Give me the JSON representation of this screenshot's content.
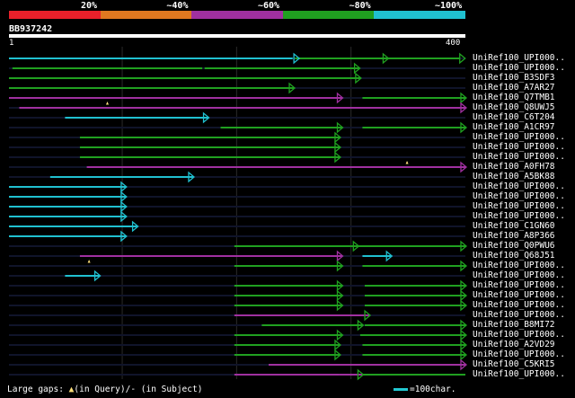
{
  "colors": {
    "bg": "#000000",
    "c20": "#e8202a",
    "c40": "#e07820",
    "c60": "#a030a0",
    "c80": "#20a020",
    "c100": "#20c0d0",
    "query": "#ffffff",
    "gap": "#ffe07a"
  },
  "legend": {
    "labels": [
      "20%",
      "~40%",
      "~60%",
      "~80%",
      "~100%"
    ]
  },
  "query": {
    "id": "BB937242",
    "start_label": "1",
    "end_label": "400",
    "length": 400
  },
  "hits": [
    {
      "name": "UniRef100_UPI000..",
      "color": "c100",
      "segs": [
        [
          1,
          249
        ],
        [
          251,
          254
        ],
        [
          325,
          332
        ]
      ],
      "arrows": [
        [
          254,
          "c100"
        ],
        [
          332,
          "c80"
        ],
        [
          399,
          "c80"
        ]
      ],
      "cont": [
        [
          254,
          325,
          "c80"
        ],
        [
          332,
          395,
          "c80"
        ]
      ]
    },
    {
      "name": "UniRef100_UPI000..",
      "color": "c80",
      "segs": [
        [
          4,
          170
        ],
        [
          172,
          307
        ]
      ],
      "arrows": [
        [
          307,
          "c80"
        ]
      ],
      "cont": []
    },
    {
      "name": "UniRef100_B3SDF3",
      "color": "c80",
      "segs": [
        [
          1,
          308
        ]
      ],
      "arrows": [
        [
          308,
          "c80"
        ]
      ],
      "cont": []
    },
    {
      "name": "UniRef100_A7AR27",
      "color": "c80",
      "segs": [
        [
          1,
          250
        ]
      ],
      "arrows": [
        [
          250,
          "c80"
        ]
      ],
      "cont": []
    },
    {
      "name": "UniRef100_Q7TMB1",
      "color": "c60",
      "segs": [
        [
          1,
          292
        ],
        [
          310,
          400
        ]
      ],
      "arrows": [
        [
          292,
          "c60"
        ],
        [
          400,
          "c80"
        ]
      ],
      "cont": []
    },
    {
      "name": "UniRef100_Q8UWJ5",
      "color": "c60",
      "segs": [
        [
          10,
          400
        ]
      ],
      "arrows": [
        [
          400,
          "c60"
        ]
      ],
      "cont": []
    },
    {
      "name": "UniRef100_C6T204",
      "color": "c100",
      "segs": [
        [
          50,
          175
        ]
      ],
      "arrows": [
        [
          175,
          "c100"
        ]
      ],
      "cont": []
    },
    {
      "name": "UniRef100_A1CR97",
      "color": "c80",
      "segs": [
        [
          186,
          292
        ],
        [
          310,
          400
        ]
      ],
      "arrows": [
        [
          292,
          "c80"
        ],
        [
          400,
          "c80"
        ]
      ],
      "cont": []
    },
    {
      "name": "UniRef100_UPI000..",
      "color": "c80",
      "segs": [
        [
          63,
          290
        ]
      ],
      "arrows": [
        [
          290,
          "c80"
        ]
      ],
      "cont": []
    },
    {
      "name": "UniRef100_UPI000..",
      "color": "c80",
      "segs": [
        [
          63,
          290
        ]
      ],
      "arrows": [
        [
          290,
          "c80"
        ]
      ],
      "cont": []
    },
    {
      "name": "UniRef100_UPI000..",
      "color": "c80",
      "segs": [
        [
          63,
          290
        ]
      ],
      "arrows": [
        [
          290,
          "c80"
        ]
      ],
      "cont": []
    },
    {
      "name": "UniRef100_A0FH78",
      "color": "c60",
      "segs": [
        [
          69,
          400
        ]
      ],
      "arrows": [
        [
          400,
          "c60"
        ]
      ],
      "cont": []
    },
    {
      "name": "UniRef100_A5BK88",
      "color": "c100",
      "segs": [
        [
          37,
          162
        ]
      ],
      "arrows": [
        [
          162,
          "c100"
        ]
      ],
      "cont": []
    },
    {
      "name": "UniRef100_UPI000..",
      "color": "c100",
      "segs": [
        [
          1,
          103
        ]
      ],
      "arrows": [
        [
          103,
          "c100"
        ]
      ],
      "cont": []
    },
    {
      "name": "UniRef100_UPI000..",
      "color": "c100",
      "segs": [
        [
          1,
          103
        ]
      ],
      "arrows": [
        [
          103,
          "c100"
        ]
      ],
      "cont": []
    },
    {
      "name": "UniRef100_UPI000..",
      "color": "c100",
      "segs": [
        [
          1,
          103
        ]
      ],
      "arrows": [
        [
          103,
          "c100"
        ]
      ],
      "cont": []
    },
    {
      "name": "UniRef100_UPI000..",
      "color": "c100",
      "segs": [
        [
          1,
          103
        ]
      ],
      "arrows": [
        [
          103,
          "c100"
        ]
      ],
      "cont": []
    },
    {
      "name": "UniRef100_C1GN60",
      "color": "c100",
      "segs": [
        [
          1,
          113
        ]
      ],
      "arrows": [
        [
          113,
          "c100"
        ]
      ],
      "cont": []
    },
    {
      "name": "UniRef100_A8P366",
      "color": "c100",
      "segs": [
        [
          1,
          103
        ]
      ],
      "arrows": [
        [
          103,
          "c100"
        ]
      ],
      "cont": []
    },
    {
      "name": "UniRef100_Q0PWU6",
      "color": "c80",
      "segs": [
        [
          198,
          306
        ],
        [
          306,
          400
        ]
      ],
      "arrows": [
        [
          306,
          "c80"
        ],
        [
          400,
          "c80"
        ]
      ],
      "cont": []
    },
    {
      "name": "UniRef100_Q68J51",
      "color": "c60",
      "segs": [
        [
          63,
          292
        ],
        [
          310,
          335
        ]
      ],
      "arrows": [
        [
          292,
          "c60"
        ],
        [
          335,
          "c100"
        ]
      ],
      "cont": []
    },
    {
      "name": "UniRef100_UPI000..",
      "color": "c80",
      "segs": [
        [
          198,
          292
        ],
        [
          310,
          400
        ]
      ],
      "arrows": [
        [
          292,
          "c80"
        ],
        [
          400,
          "c80"
        ]
      ],
      "cont": []
    },
    {
      "name": "UniRef100_UPI000..",
      "color": "c100",
      "segs": [
        [
          50,
          80
        ]
      ],
      "arrows": [
        [
          80,
          "c100"
        ]
      ],
      "cont": []
    },
    {
      "name": "UniRef100_UPI000..",
      "color": "c80",
      "segs": [
        [
          198,
          292
        ],
        [
          312,
          400
        ]
      ],
      "arrows": [
        [
          292,
          "c80"
        ],
        [
          400,
          "c80"
        ]
      ],
      "cont": []
    },
    {
      "name": "UniRef100_UPI000..",
      "color": "c80",
      "segs": [
        [
          198,
          292
        ],
        [
          312,
          400
        ]
      ],
      "arrows": [
        [
          292,
          "c80"
        ],
        [
          400,
          "c80"
        ]
      ],
      "cont": []
    },
    {
      "name": "UniRef100_UPI000..",
      "color": "c80",
      "segs": [
        [
          198,
          292
        ],
        [
          312,
          400
        ]
      ],
      "arrows": [
        [
          292,
          "c80"
        ],
        [
          400,
          "c80"
        ]
      ],
      "cont": []
    },
    {
      "name": "UniRef100_UPI000..",
      "color": "c60",
      "segs": [
        [
          198,
          316
        ]
      ],
      "arrows": [
        [
          316,
          "c80"
        ]
      ],
      "cont": []
    },
    {
      "name": "UniRef100_B8MI72",
      "color": "c80",
      "segs": [
        [
          222,
          310
        ],
        [
          312,
          400
        ]
      ],
      "arrows": [
        [
          310,
          "c80"
        ],
        [
          400,
          "c80"
        ]
      ],
      "cont": []
    },
    {
      "name": "UniRef100_UPI000..",
      "color": "c80",
      "segs": [
        [
          198,
          292
        ],
        [
          308,
          400
        ]
      ],
      "arrows": [
        [
          292,
          "c80"
        ],
        [
          400,
          "c80"
        ]
      ],
      "cont": []
    },
    {
      "name": "UniRef100_A2VD29",
      "color": "c80",
      "segs": [
        [
          198,
          290
        ],
        [
          310,
          400
        ]
      ],
      "arrows": [
        [
          290,
          "c80"
        ],
        [
          400,
          "c80"
        ]
      ],
      "cont": []
    },
    {
      "name": "UniRef100_UPI000..",
      "color": "c80",
      "segs": [
        [
          198,
          290
        ],
        [
          310,
          400
        ]
      ],
      "arrows": [
        [
          290,
          "c80"
        ],
        [
          400,
          "c80"
        ]
      ],
      "cont": []
    },
    {
      "name": "UniRef100_C5KRI5",
      "color": "c60",
      "segs": [
        [
          228,
          400
        ]
      ],
      "arrows": [
        [
          400,
          "c60"
        ]
      ],
      "cont": []
    },
    {
      "name": "UniRef100_UPI000..",
      "color": "c60",
      "segs": [
        [
          198,
          290
        ],
        [
          290,
          310
        ]
      ],
      "arrows": [
        [
          310,
          "c80"
        ]
      ],
      "cont": [
        [
          310,
          400,
          "c80"
        ]
      ]
    }
  ],
  "gaps_query": [
    [
      4,
      87
    ],
    [
      10,
      349
    ],
    [
      20,
      71
    ]
  ],
  "footer": {
    "large_gaps": "Large gaps:",
    "in_query": "(in Query)/",
    "dash": "-",
    "in_subject": "(in Subject)",
    "scale": "=100char."
  }
}
